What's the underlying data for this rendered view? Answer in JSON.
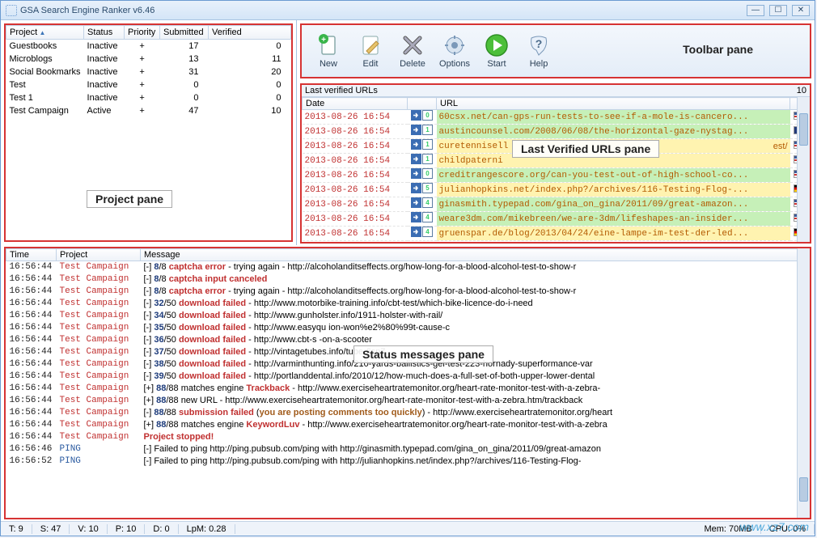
{
  "window": {
    "title": "GSA Search Engine Ranker v6.46"
  },
  "labels": {
    "project_pane": "Project pane",
    "toolbar_pane": "Toolbar pane",
    "verified_pane": "Last Verified URLs pane",
    "status_pane": "Status messages pane"
  },
  "project_table": {
    "headers": {
      "project": "Project",
      "status": "Status",
      "priority": "Priority",
      "submitted": "Submitted",
      "verified": "Verified"
    },
    "rows": [
      {
        "project": "Guestbooks",
        "status": "Inactive",
        "priority": "+",
        "submitted": 17,
        "verified": 0
      },
      {
        "project": "Microblogs",
        "status": "Inactive",
        "priority": "+",
        "submitted": 13,
        "verified": 11
      },
      {
        "project": "Social Bookmarks",
        "status": "Inactive",
        "priority": "+",
        "submitted": 31,
        "verified": 20
      },
      {
        "project": "Test",
        "status": "Inactive",
        "priority": "+",
        "submitted": 0,
        "verified": 0
      },
      {
        "project": "Test 1",
        "status": "Inactive",
        "priority": "+",
        "submitted": 0,
        "verified": 0
      },
      {
        "project": "Test Campaign",
        "status": "Active",
        "priority": "+",
        "submitted": 47,
        "verified": 10
      }
    ]
  },
  "toolbar": {
    "new": "New",
    "edit": "Edit",
    "delete": "Delete",
    "options": "Options",
    "start": "Start",
    "help": "Help"
  },
  "verified": {
    "title": "Last verified URLs",
    "count": "10",
    "headers": {
      "date": "Date",
      "url": "URL"
    },
    "rows": [
      {
        "date": "2013-08-26 16:54",
        "icon_n": "0",
        "url": "60csx.net/can-gps-run-tests-to-see-if-a-mole-is-cancero...",
        "bg": "green",
        "flag": "us"
      },
      {
        "date": "2013-08-26 16:54",
        "icon_n": "1",
        "url": "austincounsel.com/2008/06/08/the-horizontal-gaze-nystag...",
        "bg": "green",
        "flag": "uk"
      },
      {
        "date": "2013-08-26 16:54",
        "icon_n": "1",
        "url": "curetennisell",
        "bg": "yellow",
        "flag": "us",
        "tail": "est/"
      },
      {
        "date": "2013-08-26 16:54",
        "icon_n": "1",
        "url": "childpaterni",
        "bg": "yellow",
        "flag": "us"
      },
      {
        "date": "2013-08-26 16:54",
        "icon_n": "0",
        "url": "creditrangescore.org/can-you-test-out-of-high-school-co...",
        "bg": "green",
        "flag": "us"
      },
      {
        "date": "2013-08-26 16:54",
        "icon_n": "5",
        "url": "julianhopkins.net/index.php?/archives/116-Testing-Flog-...",
        "bg": "yellow",
        "flag": "de"
      },
      {
        "date": "2013-08-26 16:54",
        "icon_n": "4",
        "url": "ginasmith.typepad.com/gina_on_gina/2011/09/great-amazon...",
        "bg": "green",
        "flag": "us"
      },
      {
        "date": "2013-08-26 16:54",
        "icon_n": "4",
        "url": "weare3dm.com/mikebreen/we-are-3dm/lifeshapes-an-insider...",
        "bg": "green",
        "flag": "us"
      },
      {
        "date": "2013-08-26 16:54",
        "icon_n": "4",
        "url": "gruenspar.de/blog/2013/04/24/eine-lampe-im-test-der-led...",
        "bg": "yellow",
        "flag": "de"
      }
    ]
  },
  "messages": {
    "headers": {
      "time": "Time",
      "project": "Project",
      "message": "Message"
    },
    "rows": [
      {
        "time": "16:56:44",
        "project": "Test Campaign",
        "seg": [
          [
            "[-] ",
            ""
          ],
          [
            "8",
            1
          ],
          [
            "/8 ",
            ""
          ],
          [
            "captcha error",
            2
          ],
          [
            " - trying again - http://alcoholanditseffects.org/how-long-for-a-blood-alcohol-test-to-show-r",
            ""
          ]
        ]
      },
      {
        "time": "16:56:44",
        "project": "Test Campaign",
        "seg": [
          [
            "[-] ",
            ""
          ],
          [
            "8",
            1
          ],
          [
            "/8 ",
            ""
          ],
          [
            "captcha input canceled",
            2
          ]
        ]
      },
      {
        "time": "16:56:44",
        "project": "Test Campaign",
        "seg": [
          [
            "[-] ",
            ""
          ],
          [
            "8",
            1
          ],
          [
            "/8 ",
            ""
          ],
          [
            "captcha error",
            2
          ],
          [
            " - trying again - http://alcoholanditseffects.org/how-long-for-a-blood-alcohol-test-to-show-r",
            ""
          ]
        ]
      },
      {
        "time": "16:56:44",
        "project": "Test Campaign",
        "seg": [
          [
            "[-] ",
            ""
          ],
          [
            "32",
            1
          ],
          [
            "/50 ",
            ""
          ],
          [
            "download failed",
            2
          ],
          [
            " - http://www.motorbike-training.info/cbt-test/which-bike-licence-do-i-need",
            ""
          ]
        ]
      },
      {
        "time": "16:56:44",
        "project": "Test Campaign",
        "seg": [
          [
            "[-] ",
            ""
          ],
          [
            "34",
            1
          ],
          [
            "/50 ",
            ""
          ],
          [
            "download failed",
            2
          ],
          [
            " - http://www.gunholster.info/1911-holster-with-rail/",
            ""
          ]
        ]
      },
      {
        "time": "16:56:44",
        "project": "Test Campaign",
        "seg": [
          [
            "[-] ",
            ""
          ],
          [
            "35",
            1
          ],
          [
            "/50 ",
            ""
          ],
          [
            "download failed",
            2
          ],
          [
            " - http://www.easyqu                                          ion-won%e2%80%99t-cause-c",
            ""
          ]
        ]
      },
      {
        "time": "16:56:44",
        "project": "Test Campaign",
        "seg": [
          [
            "[-] ",
            ""
          ],
          [
            "36",
            1
          ],
          [
            "/50 ",
            ""
          ],
          [
            "download failed",
            2
          ],
          [
            " - http://www.cbt-s                                          -on-a-scooter",
            ""
          ]
        ]
      },
      {
        "time": "16:56:44",
        "project": "Test Campaign",
        "seg": [
          [
            "[-] ",
            ""
          ],
          [
            "37",
            1
          ],
          [
            "/50 ",
            ""
          ],
          [
            "download failed",
            2
          ],
          [
            " - http://vintagetubes.info/tube-6sn7",
            ""
          ]
        ]
      },
      {
        "time": "16:56:44",
        "project": "Test Campaign",
        "seg": [
          [
            "[-] ",
            ""
          ],
          [
            "38",
            1
          ],
          [
            "/50 ",
            ""
          ],
          [
            "download failed",
            2
          ],
          [
            " - http://varminthunting.info/210-yards-ballistics-gel-test-223-hornady-superformance-var",
            ""
          ]
        ]
      },
      {
        "time": "16:56:44",
        "project": "Test Campaign",
        "seg": [
          [
            "[-] ",
            ""
          ],
          [
            "39",
            1
          ],
          [
            "/50 ",
            ""
          ],
          [
            "download failed",
            2
          ],
          [
            " - http://portlanddental.info/2010/12/how-much-does-a-full-set-of-both-upper-lower-dental",
            ""
          ]
        ]
      },
      {
        "time": "16:56:44",
        "project": "Test Campaign",
        "seg": [
          [
            "[+] ",
            ""
          ],
          [
            "88",
            1
          ],
          [
            "/88 matches engine ",
            ""
          ],
          [
            "Trackback",
            3
          ],
          [
            " - http://www.exerciseheartratemonitor.org/heart-rate-monitor-test-with-a-zebra-",
            ""
          ]
        ]
      },
      {
        "time": "16:56:44",
        "project": "Test Campaign",
        "seg": [
          [
            "[+] ",
            ""
          ],
          [
            "88",
            1
          ],
          [
            "/88 new URL - http://www.exerciseheartratemonitor.org/heart-rate-monitor-test-with-a-zebra.htm/trackback",
            ""
          ]
        ]
      },
      {
        "time": "16:56:44",
        "project": "Test Campaign",
        "seg": [
          [
            "[-] ",
            ""
          ],
          [
            "88",
            1
          ],
          [
            "/88 ",
            ""
          ],
          [
            "submission failed",
            2
          ],
          [
            " (",
            ""
          ],
          [
            "you are posting comments too quickly",
            4
          ],
          [
            ") - http://www.exerciseheartratemonitor.org/heart",
            ""
          ]
        ]
      },
      {
        "time": "16:56:44",
        "project": "Test Campaign",
        "seg": [
          [
            "[+] ",
            ""
          ],
          [
            "88",
            1
          ],
          [
            "/88 matches engine ",
            ""
          ],
          [
            "KeywordLuv",
            3
          ],
          [
            " - http://www.exerciseheartratemonitor.org/heart-rate-monitor-test-with-a-zebra",
            ""
          ]
        ]
      },
      {
        "time": "16:56:44",
        "project": "Test Campaign",
        "seg": [
          [
            "Project stopped!",
            3
          ]
        ]
      },
      {
        "time": "16:56:46",
        "project": "PING",
        "ping": true,
        "seg": [
          [
            "[-] Failed to ping http://ping.pubsub.com/ping with http://ginasmith.typepad.com/gina_on_gina/2011/09/great-amazon",
            ""
          ]
        ]
      },
      {
        "time": "16:56:52",
        "project": "PING",
        "ping": true,
        "seg": [
          [
            "[-] Failed to ping http://ping.pubsub.com/ping with http://julianhopkins.net/index.php?/archives/116-Testing-Flog-",
            ""
          ]
        ]
      }
    ]
  },
  "statusbar": {
    "t": "T: 9",
    "s": "S: 47",
    "v": "V: 10",
    "p": "P: 10",
    "d": "D: 0",
    "lpm": "LpM: 0.28",
    "mem": "Mem: 70MB",
    "cpu": "CPU: 0%"
  },
  "watermark": "www.xz7.com"
}
